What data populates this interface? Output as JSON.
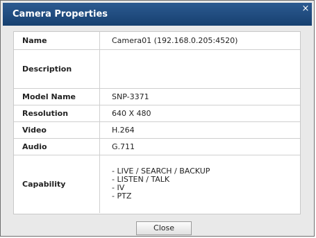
{
  "dialog": {
    "title": "Camera Properties",
    "close_icon": "×",
    "rows": [
      {
        "label": "Name",
        "value": "Camera01 (192.168.0.205:4520)"
      },
      {
        "label": "Description",
        "value": ""
      },
      {
        "label": "Model Name",
        "value": "SNP-3371"
      },
      {
        "label": "Resolution",
        "value": "640 X 480"
      },
      {
        "label": "Video",
        "value": "H.264"
      },
      {
        "label": "Audio",
        "value": "G.711"
      }
    ],
    "capability": {
      "label": "Capability",
      "items": [
        "- LIVE / SEARCH / BACKUP",
        "- LISTEN / TALK",
        "- IV",
        "- PTZ"
      ]
    },
    "close_button": "Close"
  },
  "colors": {
    "titlebar": "#1f4f86",
    "panel_bg": "#ffffff",
    "dialog_bg": "#e9e9e9"
  }
}
